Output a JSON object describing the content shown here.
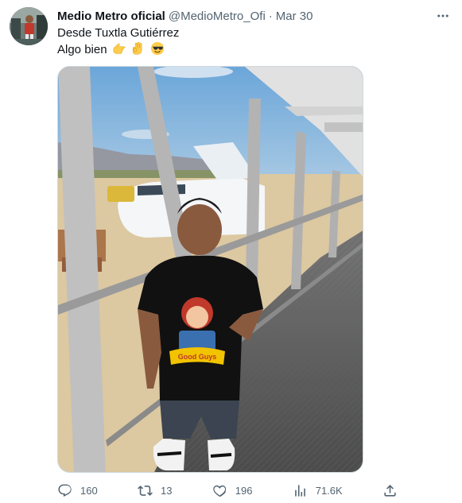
{
  "author": {
    "display_name": "Medio Metro oficial",
    "handle": "@MedioMetro_Ofi",
    "separator": "·",
    "date": "Mar 30"
  },
  "tweet": {
    "line1": "Desde Tuxtla Gutiérrez",
    "line2": "Algo bien",
    "emojis": [
      "backhand-index-pointing-left",
      "ok-hand",
      "smiling-face-with-sunglasses"
    ]
  },
  "shirt_graphic": {
    "title": "Good Guys"
  },
  "actions": {
    "replies": "160",
    "retweets": "13",
    "likes": "196",
    "views": "71.6K"
  },
  "icons": [
    "more-icon",
    "reply-icon",
    "retweet-icon",
    "like-icon",
    "views-icon",
    "share-icon"
  ],
  "colors": {
    "text": "#0f1419",
    "secondary": "#536471",
    "border": "#cfd9de"
  }
}
